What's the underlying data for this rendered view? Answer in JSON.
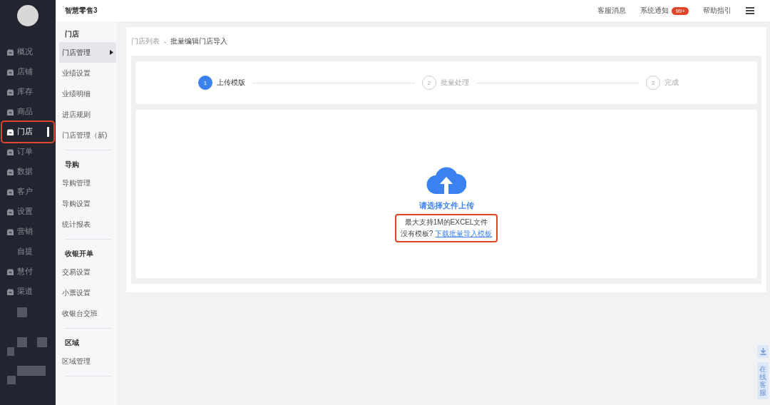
{
  "nav": {
    "items": [
      {
        "label": "概况",
        "has_icon": true,
        "selected": false
      },
      {
        "label": "店铺",
        "has_icon": true,
        "selected": false
      },
      {
        "label": "库存",
        "has_icon": true,
        "selected": false
      },
      {
        "label": "商品",
        "has_icon": true,
        "selected": false
      },
      {
        "label": "门店",
        "has_icon": true,
        "selected": true
      },
      {
        "label": "订单",
        "has_icon": true,
        "selected": false
      },
      {
        "label": "数据",
        "has_icon": true,
        "selected": false
      },
      {
        "label": "客户",
        "has_icon": true,
        "selected": false
      },
      {
        "label": "设置",
        "has_icon": true,
        "selected": false
      },
      {
        "label": "营销",
        "has_icon": true,
        "selected": false
      },
      {
        "label": "自提",
        "has_icon": false,
        "selected": false
      },
      {
        "label": "慧付",
        "has_icon": true,
        "selected": false
      },
      {
        "label": "渠道",
        "has_icon": true,
        "selected": false
      }
    ]
  },
  "submenu": {
    "title": "智慧零售3",
    "sections": [
      {
        "heading": "门店",
        "items": [
          {
            "label": "门店管理",
            "selected": true
          },
          {
            "label": "业绩设置",
            "selected": false
          },
          {
            "label": "业绩明细",
            "selected": false
          },
          {
            "label": "进店规则",
            "selected": false
          },
          {
            "label": "门店管理（新)",
            "selected": false
          }
        ]
      },
      {
        "heading": "导购",
        "items": [
          {
            "label": "导购管理",
            "selected": false
          },
          {
            "label": "导购设置",
            "selected": false
          },
          {
            "label": "统计报表",
            "selected": false
          }
        ]
      },
      {
        "heading": "收银开单",
        "items": [
          {
            "label": "交易设置",
            "selected": false
          },
          {
            "label": "小票设置",
            "selected": false
          },
          {
            "label": "收银台交班",
            "selected": false
          }
        ]
      },
      {
        "heading": "区域",
        "items": [
          {
            "label": "区域管理",
            "selected": false
          }
        ]
      }
    ]
  },
  "topbar": {
    "links": [
      {
        "label": "客服消息"
      },
      {
        "label": "系统通知",
        "badge": "99+"
      },
      {
        "label": "帮助指引"
      }
    ]
  },
  "breadcrumb": [
    "门店列表",
    "-",
    "批量编辑门店导入"
  ],
  "steps": [
    {
      "number": "1",
      "label": "上传模版",
      "selected": true
    },
    {
      "number": "2",
      "label": "批量处理",
      "selected": false
    },
    {
      "number": "3",
      "label": "完成",
      "selected": false
    }
  ],
  "upload": {
    "title": "请选择文件上传",
    "hint": "最大支持1M的EXCEL文件",
    "prompt": "没有模板?",
    "link": "下载批量导入模板"
  },
  "float_buttons": {
    "service": "在线客服"
  }
}
